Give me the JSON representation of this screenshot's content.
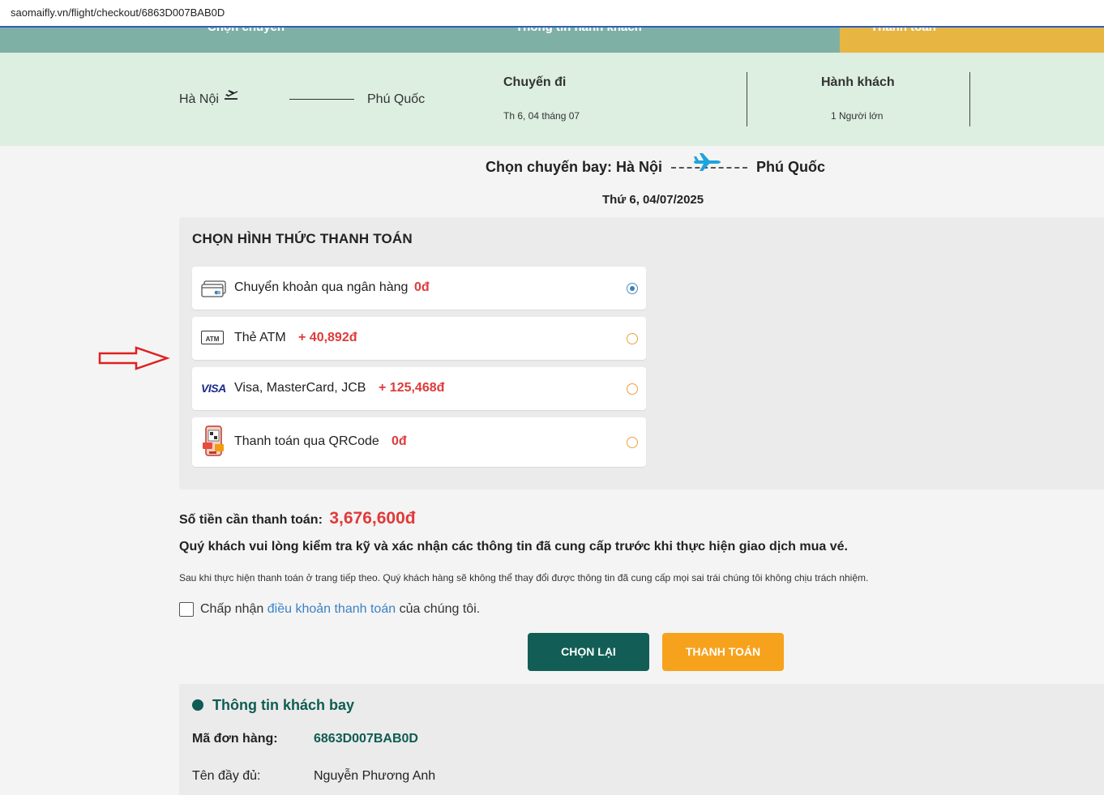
{
  "browser": {
    "url": "saomaifly.vn/flight/checkout/6863D007BAB0D"
  },
  "steps": {
    "items": [
      "Chọn chuyến",
      "Thông tin hành khách",
      "Thanh toán"
    ]
  },
  "route": {
    "from": "Hà Nội",
    "to": "Phú Quốc",
    "trip_label": "Chuyến đi",
    "trip_date": "Th 6, 04 tháng 07",
    "pax_label": "Hành khách",
    "pax_value": "1 Người lớn"
  },
  "flight": {
    "title": "Chọn chuyến bay: Hà Nội",
    "dest": "Phú Quốc",
    "date": "Thứ 6, 04/07/2025"
  },
  "payment": {
    "title": "CHỌN HÌNH THỨC THANH TOÁN",
    "options": [
      {
        "name": "Chuyển khoản qua ngân hàng",
        "fee": "0đ",
        "icon": "bank-transfer-icon",
        "selected": true
      },
      {
        "name": "Thẻ ATM",
        "fee": "+ 40,892đ",
        "icon": "atm-card-icon",
        "icon_text": "ATM",
        "selected": false
      },
      {
        "name": "Visa, MasterCard, JCB",
        "fee": "+ 125,468đ",
        "icon": "visa-icon",
        "icon_text": "VISA",
        "selected": false
      },
      {
        "name": "Thanh toán qua QRCode",
        "fee": "0đ",
        "icon": "qr-phone-icon",
        "selected": false
      }
    ]
  },
  "summary": {
    "total_label": "Số tiền cần thanh toán:",
    "total_amount": "3,676,600đ",
    "notice": "Quý khách vui lòng kiểm tra kỹ và xác nhận các thông tin đã cung cấp trước khi thực hiện giao dịch mua vé.",
    "small_note": "Sau khi thực hiện thanh toán ở trang tiếp theo. Quý khách hàng sẽ không thể thay đổi được thông tin đã cung cấp mọi sai trái chúng tôi không chịu trách nhiệm.",
    "agree_prefix": "Chấp nhận",
    "agree_link": "điều khoản thanh toán",
    "agree_suffix": "của chúng tôi."
  },
  "actions": {
    "back_label": "CHỌN LẠI",
    "pay_label": "THANH TOÁN"
  },
  "passenger": {
    "title": "Thông tin khách bay",
    "order_label": "Mã đơn hàng:",
    "order_value": "6863D007BAB0D",
    "name_label": "Tên đầy đủ:",
    "name_value": "Nguyễn Phương Anh"
  },
  "colors": {
    "accent_green": "#125e56",
    "accent_orange": "#f7a21c",
    "price_red": "#e03a3a",
    "route_bg": "#dcefe1",
    "steps_bg": "#7fb0a6"
  }
}
